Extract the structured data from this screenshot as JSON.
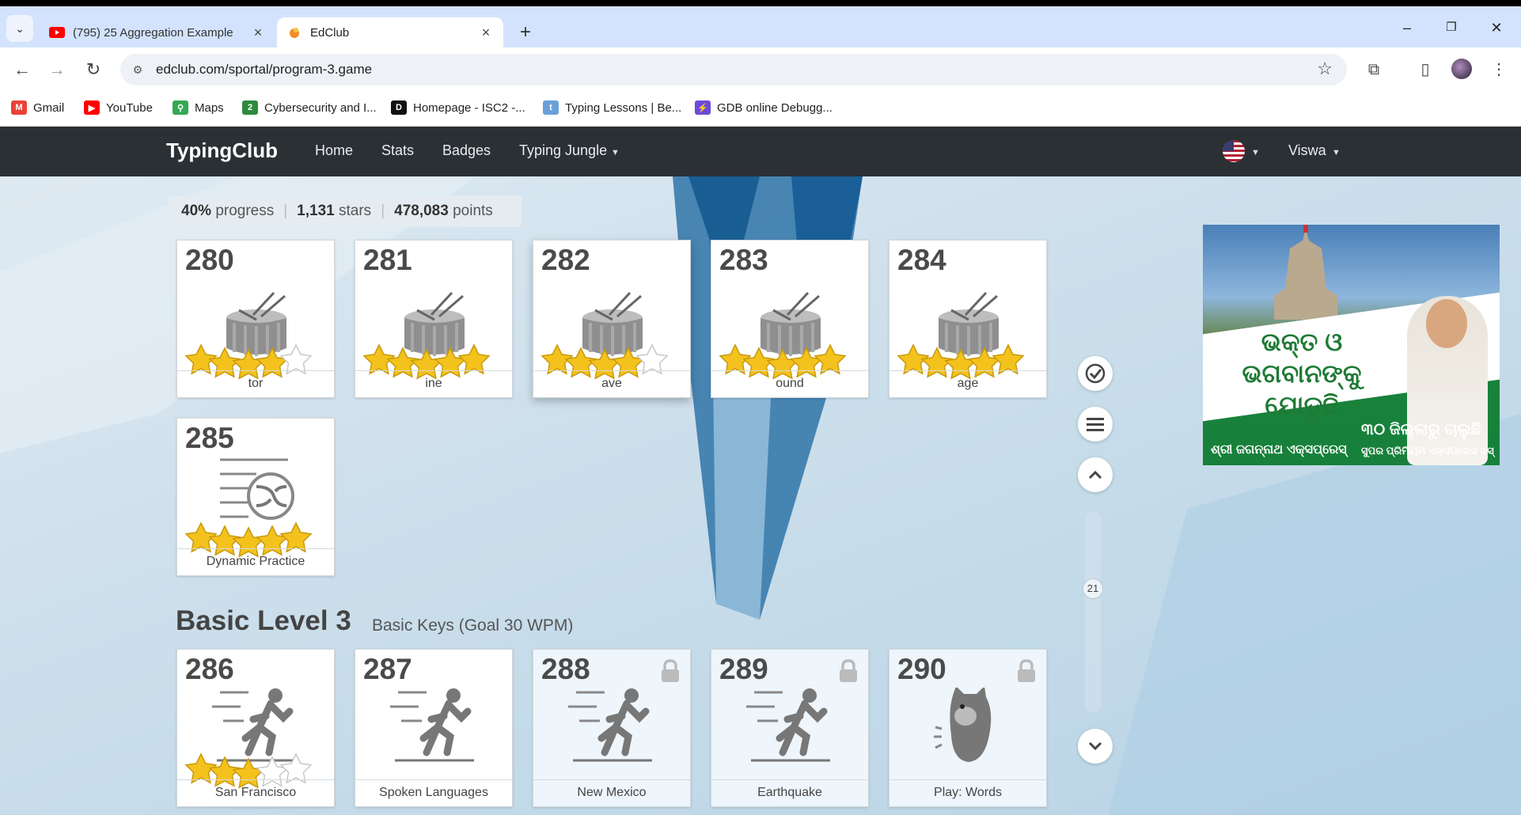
{
  "browser": {
    "tabs": [
      {
        "title": "(795) 25 Aggregation Example",
        "active": false
      },
      {
        "title": "EdClub",
        "active": true
      }
    ],
    "new_tab_symbol": "+",
    "window_buttons": {
      "minimize": "–",
      "restore": "❐",
      "close": "✕"
    },
    "url": "edclub.com/sportal/program-3.game",
    "bookmarks": [
      {
        "label": "Gmail",
        "icon": "gmail-icon"
      },
      {
        "label": "YouTube",
        "icon": "youtube-icon"
      },
      {
        "label": "Maps",
        "icon": "maps-icon"
      },
      {
        "label": "Cybersecurity and I...",
        "icon": "cybersecurity-icon"
      },
      {
        "label": "Homepage - ISC2 -...",
        "icon": "d2l-icon"
      },
      {
        "label": "Typing Lessons | Be...",
        "icon": "typing-icon"
      },
      {
        "label": "GDB online Debugg...",
        "icon": "gdb-icon"
      }
    ]
  },
  "site": {
    "brand": "TypingClub",
    "nav": [
      "Home",
      "Stats",
      "Badges",
      "Typing Jungle"
    ],
    "user": "Viswa",
    "accent_color": "#2b3034"
  },
  "progress": {
    "percent": "40%",
    "percent_label": "progress",
    "stars": "1,131",
    "stars_label": "stars",
    "points": "478,083",
    "points_label": "points"
  },
  "lessons_top": [
    {
      "num": "280",
      "label": "tor",
      "icon": "drum-icon",
      "stars": 4
    },
    {
      "num": "281",
      "label": "ine",
      "icon": "drum-icon",
      "stars": 5
    },
    {
      "num": "282",
      "label": "ave",
      "icon": "drum-icon",
      "stars": 4
    },
    {
      "num": "283",
      "label": "ound",
      "icon": "drum-icon",
      "stars": 5
    },
    {
      "num": "284",
      "label": "age",
      "icon": "drum-icon",
      "stars": 5
    },
    {
      "num": "285",
      "label": "Dynamic Practice",
      "icon": "shuffle-icon",
      "stars": 5
    }
  ],
  "level": {
    "title": "Basic Level 3",
    "subtitle": "Basic Keys (Goal 30 WPM)"
  },
  "lessons_level": [
    {
      "num": "286",
      "label": "San Francisco",
      "icon": "runner-icon",
      "stars": 3,
      "locked": false
    },
    {
      "num": "287",
      "label": "Spoken Languages",
      "icon": "runner-icon",
      "stars": 0,
      "locked": false
    },
    {
      "num": "288",
      "label": "New Mexico",
      "icon": "runner-icon",
      "stars": 0,
      "locked": true
    },
    {
      "num": "289",
      "label": "Earthquake",
      "icon": "runner-icon",
      "stars": 0,
      "locked": true
    },
    {
      "num": "290",
      "label": "Play: Words",
      "icon": "game-character-icon",
      "stars": 0,
      "locked": true
    }
  ],
  "scroller": {
    "position": "21"
  },
  "ad": {
    "headline": "ଭକ୍ତ ଓ ଭଗବାନଙ୍କୁ ଯୋଡୁଛି",
    "caption_left": "ଶ୍ରୀ ଜଗନ୍ନାଥ ଏକ୍ସପ୍ରେସ୍",
    "caption_right": "୩୦ ଜିଲ୍ଲାରୁ ଚାଲୁଛି",
    "caption_right_sub": "ସୁପର ପ୍ରିମିୟମ ଏକ୍ସପ୍ରେସ ବସ୍"
  }
}
